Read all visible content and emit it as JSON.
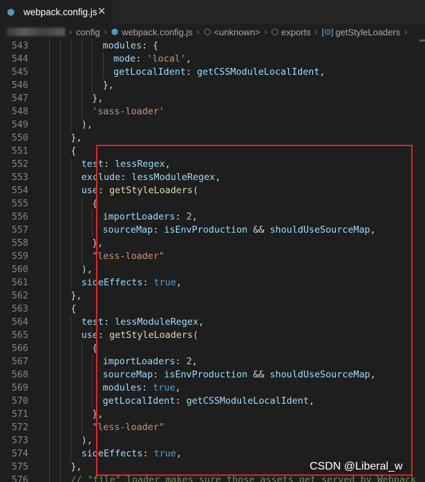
{
  "tab": {
    "filename": "webpack.config.js",
    "file_icon": "webpack-js-icon",
    "close_glyph": "✕"
  },
  "breadcrumb": {
    "separator": "›",
    "items": [
      "config",
      "webpack.config.js",
      "<unknown>",
      "exports",
      "getStyleLoaders"
    ]
  },
  "editor": {
    "lines": [
      {
        "n": "543",
        "indent": 12,
        "tokens": [
          [
            "k",
            "modules"
          ],
          [
            "p",
            ": {"
          ]
        ]
      },
      {
        "n": "544",
        "indent": 14,
        "tokens": [
          [
            "k",
            "mode"
          ],
          [
            "p",
            ": "
          ],
          [
            "s",
            "'local'"
          ],
          [
            "p",
            ","
          ]
        ]
      },
      {
        "n": "545",
        "indent": 14,
        "tokens": [
          [
            "k",
            "getLocalIdent"
          ],
          [
            "p",
            ": "
          ],
          [
            "k",
            "getCSSModuleLocalIdent"
          ],
          [
            "p",
            ","
          ]
        ]
      },
      {
        "n": "546",
        "indent": 12,
        "tokens": [
          [
            "p",
            "},"
          ]
        ]
      },
      {
        "n": "547",
        "indent": 10,
        "tokens": [
          [
            "p",
            "},"
          ]
        ]
      },
      {
        "n": "548",
        "indent": 10,
        "tokens": [
          [
            "s",
            "'sass-loader'"
          ]
        ]
      },
      {
        "n": "549",
        "indent": 8,
        "tokens": [
          [
            "p",
            "),"
          ]
        ]
      },
      {
        "n": "550",
        "indent": 6,
        "tokens": [
          [
            "p",
            "},"
          ]
        ]
      },
      {
        "n": "551",
        "indent": 6,
        "tokens": [
          [
            "p",
            "{"
          ]
        ]
      },
      {
        "n": "552",
        "indent": 8,
        "tokens": [
          [
            "k",
            "test"
          ],
          [
            "p",
            ": "
          ],
          [
            "k",
            "lessRegex"
          ],
          [
            "p",
            ","
          ]
        ]
      },
      {
        "n": "553",
        "indent": 8,
        "tokens": [
          [
            "k",
            "exclude"
          ],
          [
            "p",
            ": "
          ],
          [
            "k",
            "lessModuleRegex"
          ],
          [
            "p",
            ","
          ]
        ]
      },
      {
        "n": "554",
        "indent": 8,
        "tokens": [
          [
            "k",
            "use"
          ],
          [
            "p",
            ": "
          ],
          [
            "f",
            "getStyleLoaders"
          ],
          [
            "p",
            "("
          ]
        ]
      },
      {
        "n": "555",
        "indent": 10,
        "tokens": [
          [
            "p",
            "{"
          ]
        ]
      },
      {
        "n": "556",
        "indent": 12,
        "tokens": [
          [
            "k",
            "importLoaders"
          ],
          [
            "p",
            ": "
          ],
          [
            "n",
            "2"
          ],
          [
            "p",
            ","
          ]
        ]
      },
      {
        "n": "557",
        "indent": 12,
        "tokens": [
          [
            "k",
            "sourceMap"
          ],
          [
            "p",
            ": "
          ],
          [
            "k",
            "isEnvProduction"
          ],
          [
            "p",
            " && "
          ],
          [
            "k",
            "shouldUseSourceMap"
          ],
          [
            "p",
            ","
          ]
        ]
      },
      {
        "n": "558",
        "indent": 10,
        "tokens": [
          [
            "p",
            "},"
          ]
        ]
      },
      {
        "n": "559",
        "indent": 10,
        "tokens": [
          [
            "s",
            "\"less-loader\""
          ]
        ]
      },
      {
        "n": "560",
        "indent": 8,
        "tokens": [
          [
            "p",
            "),"
          ]
        ]
      },
      {
        "n": "561",
        "indent": 8,
        "tokens": [
          [
            "k",
            "sideEffects"
          ],
          [
            "p",
            ": "
          ],
          [
            "b",
            "true"
          ],
          [
            "p",
            ","
          ]
        ]
      },
      {
        "n": "562",
        "indent": 6,
        "tokens": [
          [
            "p",
            "},"
          ]
        ]
      },
      {
        "n": "563",
        "indent": 6,
        "tokens": [
          [
            "p",
            "{"
          ]
        ]
      },
      {
        "n": "564",
        "indent": 8,
        "tokens": [
          [
            "k",
            "test"
          ],
          [
            "p",
            ": "
          ],
          [
            "k",
            "lessModuleRegex"
          ],
          [
            "p",
            ","
          ]
        ]
      },
      {
        "n": "565",
        "indent": 8,
        "tokens": [
          [
            "k",
            "use"
          ],
          [
            "p",
            ": "
          ],
          [
            "f",
            "getStyleLoaders"
          ],
          [
            "p",
            "("
          ]
        ]
      },
      {
        "n": "566",
        "indent": 10,
        "tokens": [
          [
            "p",
            "{"
          ]
        ]
      },
      {
        "n": "567",
        "indent": 12,
        "tokens": [
          [
            "k",
            "importLoaders"
          ],
          [
            "p",
            ": "
          ],
          [
            "n",
            "2"
          ],
          [
            "p",
            ","
          ]
        ]
      },
      {
        "n": "568",
        "indent": 12,
        "tokens": [
          [
            "k",
            "sourceMap"
          ],
          [
            "p",
            ": "
          ],
          [
            "k",
            "isEnvProduction"
          ],
          [
            "p",
            " && "
          ],
          [
            "k",
            "shouldUseSourceMap"
          ],
          [
            "p",
            ","
          ]
        ]
      },
      {
        "n": "569",
        "indent": 12,
        "tokens": [
          [
            "k",
            "modules"
          ],
          [
            "p",
            ": "
          ],
          [
            "b",
            "true"
          ],
          [
            "p",
            ","
          ]
        ]
      },
      {
        "n": "570",
        "indent": 12,
        "tokens": [
          [
            "k",
            "getLocalIdent"
          ],
          [
            "p",
            ": "
          ],
          [
            "k",
            "getCSSModuleLocalIdent"
          ],
          [
            "p",
            ","
          ]
        ]
      },
      {
        "n": "571",
        "indent": 10,
        "tokens": [
          [
            "p",
            "},"
          ]
        ]
      },
      {
        "n": "572",
        "indent": 10,
        "tokens": [
          [
            "s",
            "\"less-loader\""
          ]
        ]
      },
      {
        "n": "573",
        "indent": 8,
        "tokens": [
          [
            "p",
            "),"
          ]
        ]
      },
      {
        "n": "574",
        "indent": 8,
        "tokens": [
          [
            "k",
            "sideEffects"
          ],
          [
            "p",
            ": "
          ],
          [
            "b",
            "true"
          ],
          [
            "p",
            ","
          ]
        ]
      },
      {
        "n": "575",
        "indent": 6,
        "tokens": [
          [
            "p",
            "},"
          ]
        ]
      },
      {
        "n": "576",
        "indent": 6,
        "tokens": [
          [
            "c",
            "// \"file\" loader makes sure those assets get served by Webpack"
          ]
        ]
      }
    ]
  },
  "watermark": "CSDN @Liberal_w",
  "colors": {
    "highlight_box": "#e32525",
    "keyword": "#9cdcfe",
    "string": "#ce9178",
    "function": "#dcdcaa",
    "number": "#b5cea8",
    "boolean": "#569cd6",
    "comment": "#6a9955"
  }
}
